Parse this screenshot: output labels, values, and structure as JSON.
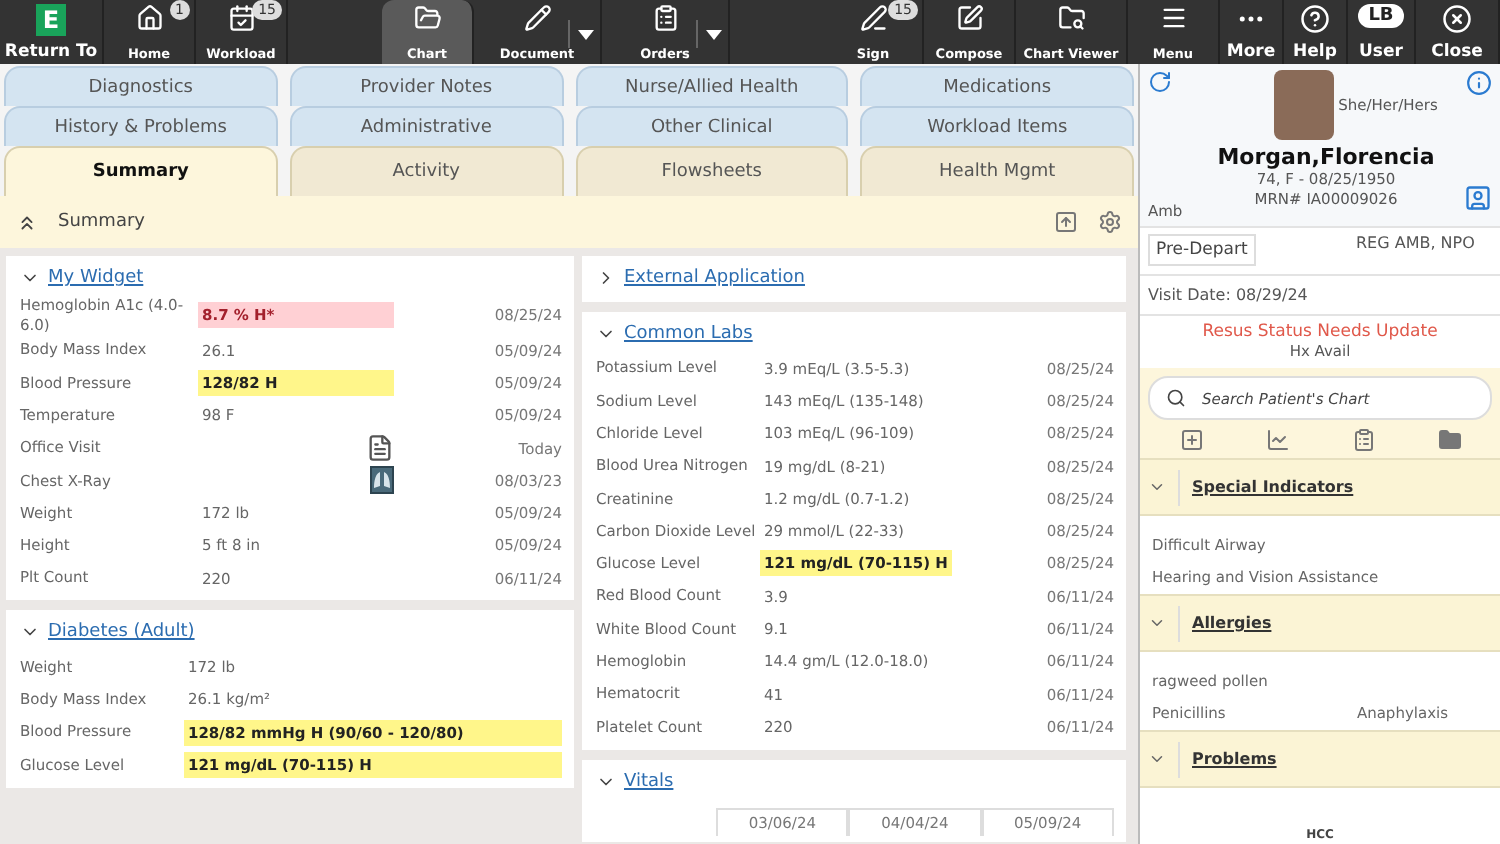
{
  "toolbar": {
    "items": [
      {
        "label": "Return To",
        "kind": "main",
        "logo_letter": "E",
        "selected": false
      },
      {
        "label": "Home",
        "kind": "app",
        "badge": "1",
        "selected": false
      },
      {
        "label": "Workload",
        "kind": "app",
        "badge": "15",
        "selected": false
      },
      {
        "label": "Chart",
        "kind": "app",
        "selected": true
      },
      {
        "label": "Document",
        "kind": "app",
        "dropdown": true,
        "selected": false
      },
      {
        "label": "Orders",
        "kind": "app",
        "dropdown": true,
        "selected": false
      },
      {
        "label": "Sign",
        "kind": "app",
        "badge": "15",
        "selected": false
      },
      {
        "label": "Compose",
        "kind": "app",
        "selected": false
      },
      {
        "label": "Chart Viewer",
        "kind": "app",
        "selected": false
      },
      {
        "label": "Menu",
        "kind": "app",
        "selected": false
      },
      {
        "label": "More",
        "kind": "main",
        "selected": false
      },
      {
        "label": "Help",
        "kind": "main",
        "selected": false
      },
      {
        "label": "User",
        "kind": "main",
        "avatar_text": "LB",
        "selected": false
      },
      {
        "label": "Close",
        "kind": "main",
        "selected": false
      }
    ]
  },
  "tab_rows": [
    {
      "kind": "secondary",
      "tabs": [
        {
          "label": "Diagnostics",
          "selected": false
        },
        {
          "label": "Provider Notes",
          "selected": false
        },
        {
          "label": "Nurse/Allied Health",
          "selected": false
        },
        {
          "label": "Medications",
          "selected": false
        }
      ]
    },
    {
      "kind": "secondary",
      "tabs": [
        {
          "label": "History & Problems",
          "selected": false
        },
        {
          "label": "Administrative",
          "selected": false
        },
        {
          "label": "Other Clinical",
          "selected": false
        },
        {
          "label": "Workload Items",
          "selected": false
        }
      ]
    },
    {
      "kind": "primary",
      "tabs": [
        {
          "label": "Summary",
          "selected": true
        },
        {
          "label": "Activity",
          "selected": false
        },
        {
          "label": "Flowsheets",
          "selected": false
        },
        {
          "label": "Health Mgmt",
          "selected": false
        }
      ]
    }
  ],
  "summary_header": {
    "title": "Summary"
  },
  "my_widget": {
    "title": "My Widget",
    "expanded": true,
    "rows": [
      {
        "label": "Hemoglobin A1c (4.0-6.0)",
        "kind": "text",
        "value": "8.7 % H*",
        "abnormal": true,
        "critical": true,
        "date": "08/25/24"
      },
      {
        "label": "Body Mass Index",
        "kind": "text",
        "value": "26.1",
        "abnormal": false,
        "critical": false,
        "date": "05/09/24"
      },
      {
        "label": "Blood Pressure",
        "kind": "text",
        "value": "128/82 H",
        "abnormal": true,
        "critical": false,
        "date": "05/09/24"
      },
      {
        "label": "Temperature",
        "kind": "text",
        "value": "98 F",
        "abnormal": false,
        "critical": false,
        "date": "05/09/24"
      },
      {
        "label": "Office Visit",
        "kind": "document",
        "date": "Today"
      },
      {
        "label": "Chest X-Ray",
        "kind": "image",
        "date": "08/03/23"
      },
      {
        "label": "Weight",
        "kind": "text",
        "value": "172 lb",
        "abnormal": false,
        "critical": false,
        "date": "05/09/24"
      },
      {
        "label": "Height",
        "kind": "text",
        "value": "5 ft 8 in",
        "abnormal": false,
        "critical": false,
        "date": "05/09/24"
      },
      {
        "label": "Plt Count",
        "kind": "text",
        "value": "220",
        "abnormal": false,
        "critical": false,
        "date": "06/11/24"
      }
    ]
  },
  "diabetes_widget": {
    "title": "Diabetes (Adult)",
    "expanded": true,
    "rows": [
      {
        "label": "Weight",
        "value": "172 lb",
        "abnormal": false,
        "critical": false
      },
      {
        "label": "Body Mass Index",
        "value": "26.1 kg/m²",
        "abnormal": false,
        "critical": false
      },
      {
        "label": "Blood Pressure",
        "value": "128/82 mmHg H (90/60 - 120/80)",
        "abnormal": true,
        "critical": false
      },
      {
        "label": "Glucose Level",
        "value": "121 mg/dL (70-115) H",
        "abnormal": true,
        "critical": false
      }
    ]
  },
  "external_application": {
    "title": "External Application",
    "expanded": false
  },
  "common_labs": {
    "title": "Common Labs",
    "expanded": true,
    "rows": [
      {
        "label": "Potassium Level",
        "value": "3.9 mEq/L (3.5-5.3)",
        "abnormal": false,
        "critical": false,
        "date": "08/25/24"
      },
      {
        "label": "Sodium Level",
        "value": "143 mEq/L (135-148)",
        "abnormal": false,
        "critical": false,
        "date": "08/25/24"
      },
      {
        "label": "Chloride Level",
        "value": "103 mEq/L (96-109)",
        "abnormal": false,
        "critical": false,
        "date": "08/25/24"
      },
      {
        "label": "Blood Urea Nitrogen",
        "value": "19 mg/dL (8-21)",
        "abnormal": false,
        "critical": false,
        "date": "08/25/24"
      },
      {
        "label": "Creatinine",
        "value": "1.2 mg/dL (0.7-1.2)",
        "abnormal": false,
        "critical": false,
        "date": "08/25/24"
      },
      {
        "label": "Carbon Dioxide Level",
        "value": "29 mmol/L (22-33)",
        "abnormal": false,
        "critical": false,
        "date": "08/25/24"
      },
      {
        "label": "Glucose Level",
        "value": "121 mg/dL (70-115) H",
        "abnormal": true,
        "critical": false,
        "date": "08/25/24"
      },
      {
        "label": "Red Blood Count",
        "value": "3.9",
        "abnormal": false,
        "critical": false,
        "date": "06/11/24"
      },
      {
        "label": "White Blood Count",
        "value": "9.1",
        "abnormal": false,
        "critical": false,
        "date": "06/11/24"
      },
      {
        "label": "Hemoglobin",
        "value": "14.4 gm/L (12.0-18.0)",
        "abnormal": false,
        "critical": false,
        "date": "06/11/24"
      },
      {
        "label": "Hematocrit",
        "value": "41",
        "abnormal": false,
        "critical": false,
        "date": "06/11/24"
      },
      {
        "label": "Platelet Count",
        "value": "220",
        "abnormal": false,
        "critical": false,
        "date": "06/11/24"
      }
    ]
  },
  "vitals": {
    "title": "Vitals",
    "expanded": true,
    "columns": [
      "03/06/24",
      "04/04/24",
      "05/09/24"
    ]
  },
  "patient": {
    "pronouns": "She/Her/Hers",
    "name": "Morgan,Florencia",
    "encounter_type": "Amb",
    "age_sex_dob": "74, F - 08/25/1950",
    "mrn": "MRN# IA00009026",
    "status": "Pre-Depart",
    "location": "REG AMB, NPO",
    "visit_date": "Visit Date: 08/29/24",
    "alert": "Resus Status Needs Update",
    "history": "Hx Avail"
  },
  "search": {
    "placeholder": "Search Patient's Chart"
  },
  "sections": [
    {
      "title": "Special Indicators",
      "expanded": true,
      "items": [
        {
          "text": "Difficult Airway"
        },
        {
          "text": "Hearing and Vision Assistance"
        }
      ]
    },
    {
      "title": "Allergies",
      "expanded": true,
      "items": [
        {
          "text": "ragweed pollen"
        },
        {
          "text": "Penicillins",
          "detail": "Anaphylaxis"
        }
      ]
    },
    {
      "title": "Problems",
      "expanded": true,
      "note": "HCC"
    }
  ]
}
